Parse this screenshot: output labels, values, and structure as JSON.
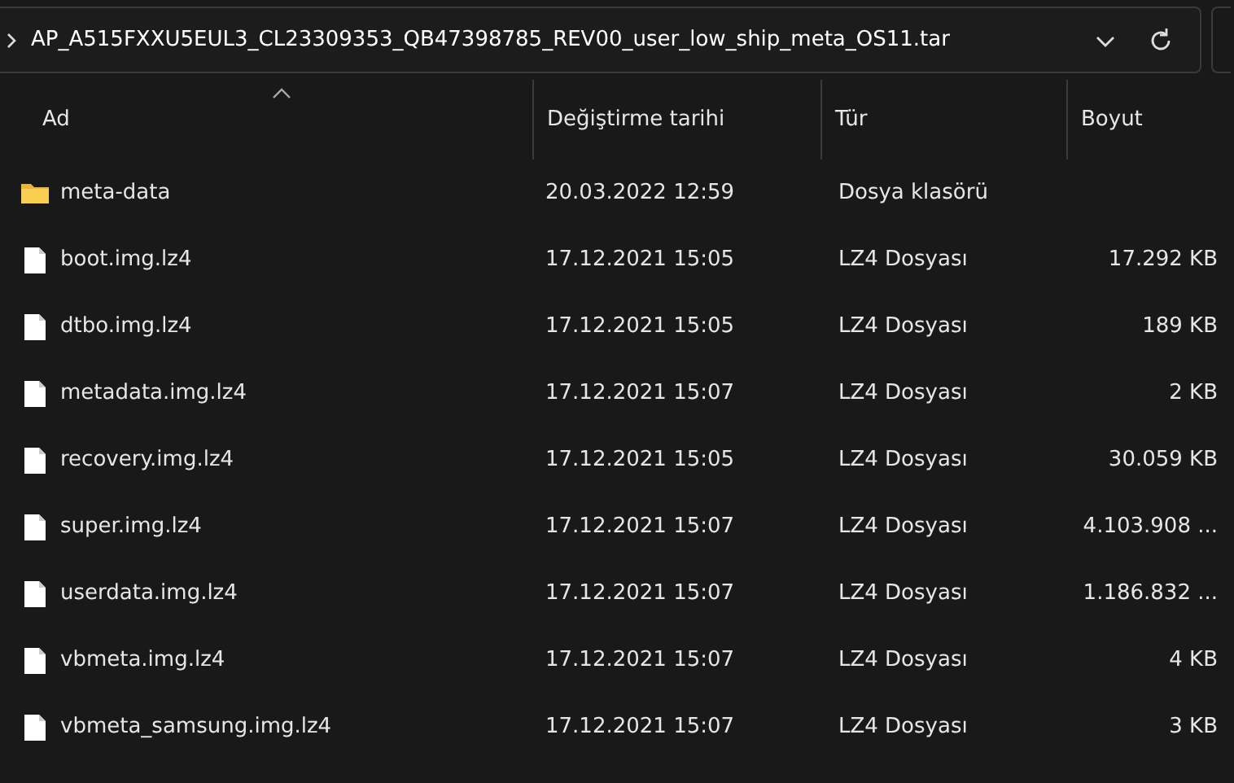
{
  "address_bar": {
    "path": "AP_A515FXXU5EUL3_CL23309353_QB47398785_REV00_user_low_ship_meta_OS11.tar"
  },
  "columns": [
    {
      "label": "Ad",
      "sorted": true
    },
    {
      "label": "Değiştirme tarihi",
      "sorted": false
    },
    {
      "label": "Tür",
      "sorted": false
    },
    {
      "label": "Boyut",
      "sorted": false
    }
  ],
  "rows": [
    {
      "kind": "folder",
      "name": "meta-data",
      "date": "20.03.2022 12:59",
      "type": "Dosya klasörü",
      "size": ""
    },
    {
      "kind": "file",
      "name": "boot.img.lz4",
      "date": "17.12.2021 15:05",
      "type": "LZ4 Dosyası",
      "size": "17.292 KB"
    },
    {
      "kind": "file",
      "name": "dtbo.img.lz4",
      "date": "17.12.2021 15:05",
      "type": "LZ4 Dosyası",
      "size": "189 KB"
    },
    {
      "kind": "file",
      "name": "metadata.img.lz4",
      "date": "17.12.2021 15:07",
      "type": "LZ4 Dosyası",
      "size": "2 KB"
    },
    {
      "kind": "file",
      "name": "recovery.img.lz4",
      "date": "17.12.2021 15:05",
      "type": "LZ4 Dosyası",
      "size": "30.059 KB"
    },
    {
      "kind": "file",
      "name": "super.img.lz4",
      "date": "17.12.2021 15:07",
      "type": "LZ4 Dosyası",
      "size": "4.103.908 ..."
    },
    {
      "kind": "file",
      "name": "userdata.img.lz4",
      "date": "17.12.2021 15:07",
      "type": "LZ4 Dosyası",
      "size": "1.186.832 ..."
    },
    {
      "kind": "file",
      "name": "vbmeta.img.lz4",
      "date": "17.12.2021 15:07",
      "type": "LZ4 Dosyası",
      "size": "4 KB"
    },
    {
      "kind": "file",
      "name": "vbmeta_samsung.img.lz4",
      "date": "17.12.2021 15:07",
      "type": "LZ4 Dosyası",
      "size": "3 KB"
    }
  ]
}
